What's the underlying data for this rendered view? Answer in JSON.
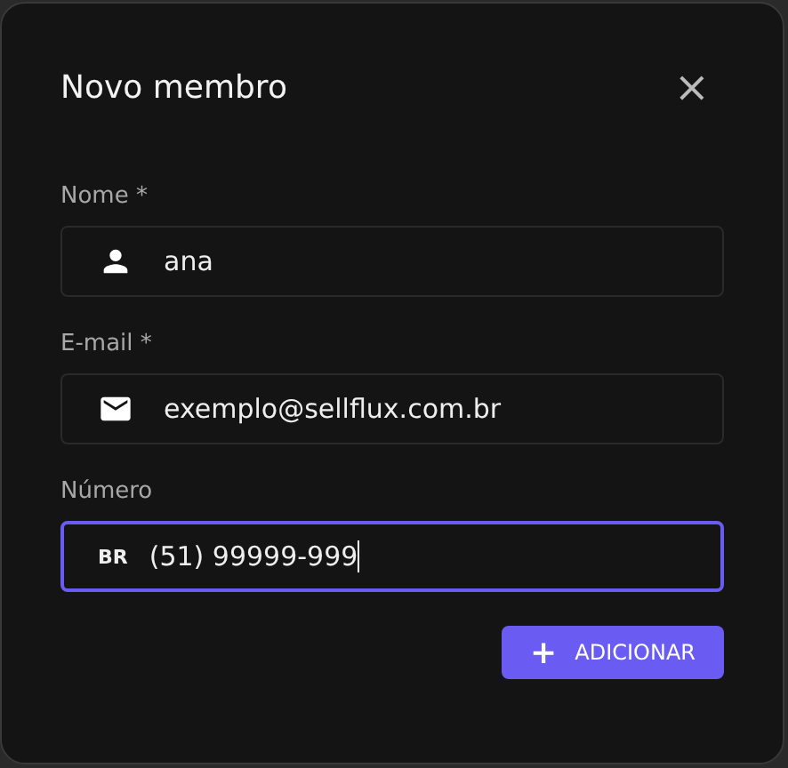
{
  "dialog": {
    "title": "Novo membro",
    "close": "×"
  },
  "fields": [
    {
      "kind": "name",
      "label": "Nome *",
      "value": "ana",
      "focused": false
    },
    {
      "kind": "email",
      "label": "E-mail *",
      "value": "exemplo@sellflux.com.br",
      "focused": false
    },
    {
      "kind": "phone",
      "label": "Número",
      "prefix": "BR",
      "value": "(51) 99999-999",
      "focused": true
    }
  ],
  "submit": {
    "label": "ADICIONAR",
    "icon": "+"
  }
}
